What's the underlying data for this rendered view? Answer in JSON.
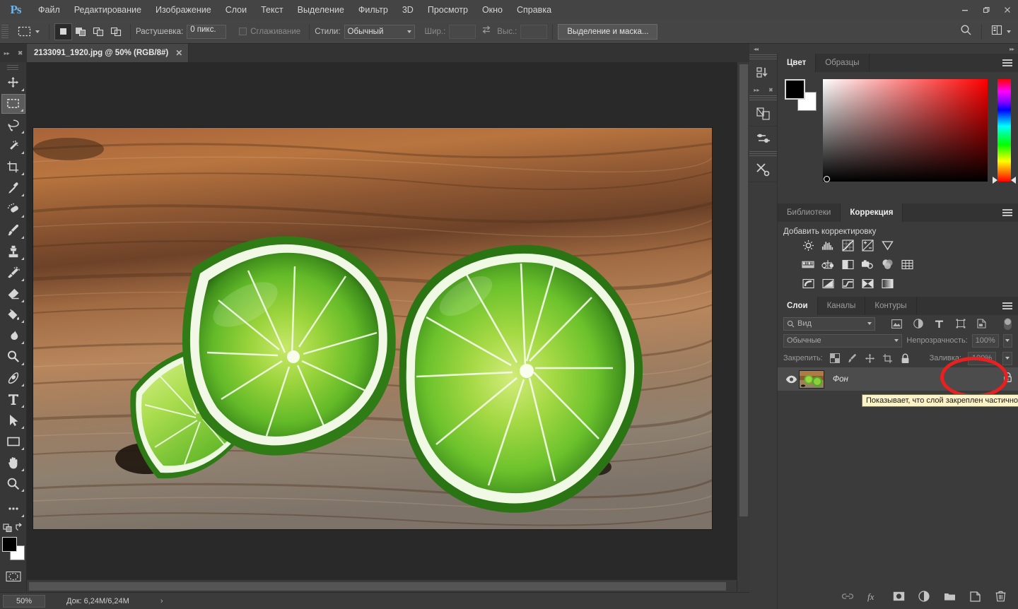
{
  "app": {
    "logo": "Ps",
    "menus": [
      "Файл",
      "Редактирование",
      "Изображение",
      "Слои",
      "Текст",
      "Выделение",
      "Фильтр",
      "3D",
      "Просмотр",
      "Окно",
      "Справка"
    ],
    "window_buttons": [
      {
        "name": "minimize",
        "glyph": "—"
      },
      {
        "name": "restore",
        "glyph": "❐"
      },
      {
        "name": "close",
        "glyph": "✕"
      }
    ]
  },
  "options_bar": {
    "tool_preset_icon": "rectangular-marquee-icon",
    "selection_modes": [
      "new-selection",
      "add-to-selection",
      "subtract-from-selection",
      "intersect-with-selection"
    ],
    "active_selection_mode": 0,
    "feather_label": "Растушевка:",
    "feather_value": "0 пикс.",
    "antialias_label": "Сглаживание",
    "antialias_checked": false,
    "style_label": "Стили:",
    "style_value": "Обычный",
    "width_label": "Шир.:",
    "width_value": "",
    "swap_icon": "swap-dimensions-icon",
    "height_label": "Выс.:",
    "height_value": "",
    "select_mask_button": "Выделение и маска...",
    "search_icon": "search-icon",
    "workspace_icon": "workspace-switcher-icon"
  },
  "toolbar": {
    "tools": [
      {
        "name": "move-tool",
        "label": "Перемещение",
        "selected": false
      },
      {
        "name": "rectangular-marquee-tool",
        "label": "Прямоугольная область",
        "selected": true
      },
      {
        "name": "lasso-tool",
        "label": "Лассо",
        "selected": false
      },
      {
        "name": "magic-wand-tool",
        "label": "Волшебная палочка",
        "selected": false
      },
      {
        "name": "crop-tool",
        "label": "Рамка",
        "selected": false
      },
      {
        "name": "eyedropper-tool",
        "label": "Пипетка",
        "selected": false
      },
      {
        "name": "healing-brush-tool",
        "label": "Восстанавливающая кисть",
        "selected": false
      },
      {
        "name": "brush-tool",
        "label": "Кисть",
        "selected": false
      },
      {
        "name": "clone-stamp-tool",
        "label": "Штамп",
        "selected": false
      },
      {
        "name": "history-brush-tool",
        "label": "Архивная кисть",
        "selected": false
      },
      {
        "name": "eraser-tool",
        "label": "Ластик",
        "selected": false
      },
      {
        "name": "gradient-tool",
        "label": "Заливка",
        "selected": false
      },
      {
        "name": "blur-tool",
        "label": "Размытие",
        "selected": false
      },
      {
        "name": "dodge-tool",
        "label": "Осветлитель",
        "selected": false
      },
      {
        "name": "pen-tool",
        "label": "Перо",
        "selected": false
      },
      {
        "name": "type-tool",
        "label": "Текст",
        "selected": false
      },
      {
        "name": "path-selection-tool",
        "label": "Выделение контура",
        "selected": false
      },
      {
        "name": "rectangle-tool",
        "label": "Прямоугольник",
        "selected": false
      },
      {
        "name": "hand-tool",
        "label": "Рука",
        "selected": false
      },
      {
        "name": "zoom-tool",
        "label": "Масштаб",
        "selected": false
      }
    ],
    "more_tools_icon": "ellipsis-icon",
    "swap_colors_icon": "swap-colors-icon",
    "default_colors_icon": "default-colors-icon",
    "foreground_color": "#000000",
    "background_color": "#ffffff",
    "quick_mask_icon": "quick-mask-icon",
    "screen_mode_icon": "screen-mode-icon"
  },
  "document": {
    "tab_title": "2133091_1920.jpg @ 50% (RGB/8#)",
    "tab_close": "✕",
    "collapse_icon": "collapse-icon",
    "close_icon": "close-icon"
  },
  "status_bar": {
    "zoom": "50%",
    "doc_info": "Док: 6,24M/6,24M",
    "expand_arrow": "›"
  },
  "color_panel": {
    "tabs": [
      {
        "label": "Цвет",
        "active": true
      },
      {
        "label": "Образцы",
        "active": false
      }
    ],
    "menu_icon": "panel-menu-icon",
    "foreground_color": "#000000",
    "background_color": "#ffffff",
    "ramp_base_color": "#ff0000"
  },
  "adjustments_panel": {
    "tabs": [
      {
        "label": "Библиотеки",
        "active": false
      },
      {
        "label": "Коррекция",
        "active": true
      }
    ],
    "menu_icon": "panel-menu-icon",
    "title": "Добавить корректировку",
    "row1": [
      "brightness-contrast-icon",
      "levels-icon",
      "curves-icon",
      "exposure-icon",
      "vibrance-icon"
    ],
    "row2": [
      "hue-saturation-icon",
      "color-balance-icon",
      "black-white-icon",
      "photo-filter-icon",
      "channel-mixer-icon",
      "color-lookup-icon"
    ],
    "row3": [
      "invert-icon",
      "posterize-icon",
      "threshold-icon",
      "selective-color-icon",
      "gradient-map-icon"
    ]
  },
  "layers_panel": {
    "tabs": [
      {
        "label": "Слои",
        "active": true
      },
      {
        "label": "Каналы",
        "active": false
      },
      {
        "label": "Контуры",
        "active": false
      }
    ],
    "menu_icon": "panel-menu-icon",
    "filter_placeholder": "Вид",
    "search_icon": "search-icon",
    "filter_icons": [
      "filter-pixel-icon",
      "filter-adjustment-icon",
      "filter-type-icon",
      "filter-shape-icon",
      "filter-smart-object-icon"
    ],
    "filter_toggle": "filter-enable-toggle",
    "blend_mode": "Обычные",
    "opacity_label": "Непрозрачность:",
    "opacity_value": "100%",
    "lock_label": "Закрепить:",
    "lock_icons": [
      "lock-transparency-icon",
      "lock-image-icon",
      "lock-position-icon",
      "lock-artboard-icon",
      "lock-all-icon"
    ],
    "fill_label": "Заливка:",
    "fill_value": "100%",
    "layers": [
      {
        "name": "Фон",
        "visible": true,
        "visibility_icon": "eye-icon",
        "lock_icon": "lock-icon",
        "thumbnail": "limes-on-wood-thumbnail",
        "selected": true
      }
    ],
    "footer_icons": [
      "link-layers-icon",
      "layer-style-fx-icon",
      "add-layer-mask-icon",
      "new-fill-adjustment-icon",
      "new-group-icon",
      "new-layer-icon",
      "delete-layer-icon"
    ]
  },
  "mini_dock": {
    "buttons": [
      "history-icon",
      "layer-comps-icon",
      "properties-icon",
      "tools-icon"
    ],
    "expand_icon": "expand-icon",
    "close_icon": "close-icon"
  },
  "annotation": {
    "ellipse_color": "#e8201f",
    "tooltip_text": "Показывает, что слой закреплен частично"
  },
  "canvas": {
    "image_description": "limes-on-wooden-board",
    "background_color": "#292929"
  }
}
